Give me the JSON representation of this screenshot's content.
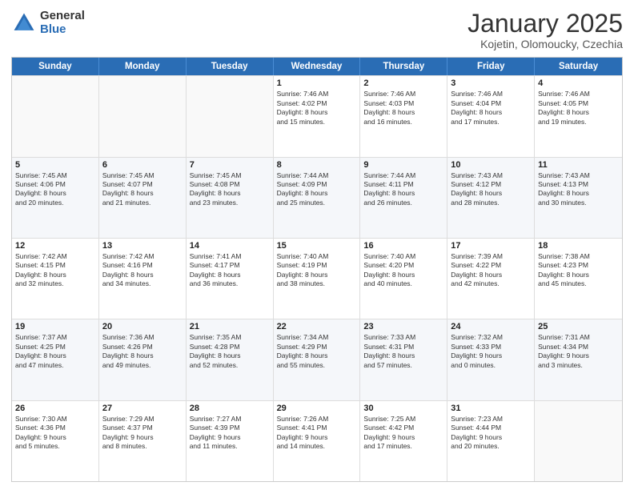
{
  "logo": {
    "general": "General",
    "blue": "Blue"
  },
  "title": {
    "month": "January 2025",
    "location": "Kojetin, Olomoucky, Czechia"
  },
  "days": [
    "Sunday",
    "Monday",
    "Tuesday",
    "Wednesday",
    "Thursday",
    "Friday",
    "Saturday"
  ],
  "weeks": [
    [
      {
        "day": "",
        "lines": [],
        "empty": true
      },
      {
        "day": "",
        "lines": [],
        "empty": true
      },
      {
        "day": "",
        "lines": [],
        "empty": true
      },
      {
        "day": "1",
        "lines": [
          "Sunrise: 7:46 AM",
          "Sunset: 4:02 PM",
          "Daylight: 8 hours",
          "and 15 minutes."
        ],
        "empty": false
      },
      {
        "day": "2",
        "lines": [
          "Sunrise: 7:46 AM",
          "Sunset: 4:03 PM",
          "Daylight: 8 hours",
          "and 16 minutes."
        ],
        "empty": false
      },
      {
        "day": "3",
        "lines": [
          "Sunrise: 7:46 AM",
          "Sunset: 4:04 PM",
          "Daylight: 8 hours",
          "and 17 minutes."
        ],
        "empty": false
      },
      {
        "day": "4",
        "lines": [
          "Sunrise: 7:46 AM",
          "Sunset: 4:05 PM",
          "Daylight: 8 hours",
          "and 19 minutes."
        ],
        "empty": false
      }
    ],
    [
      {
        "day": "5",
        "lines": [
          "Sunrise: 7:45 AM",
          "Sunset: 4:06 PM",
          "Daylight: 8 hours",
          "and 20 minutes."
        ],
        "empty": false
      },
      {
        "day": "6",
        "lines": [
          "Sunrise: 7:45 AM",
          "Sunset: 4:07 PM",
          "Daylight: 8 hours",
          "and 21 minutes."
        ],
        "empty": false
      },
      {
        "day": "7",
        "lines": [
          "Sunrise: 7:45 AM",
          "Sunset: 4:08 PM",
          "Daylight: 8 hours",
          "and 23 minutes."
        ],
        "empty": false
      },
      {
        "day": "8",
        "lines": [
          "Sunrise: 7:44 AM",
          "Sunset: 4:09 PM",
          "Daylight: 8 hours",
          "and 25 minutes."
        ],
        "empty": false
      },
      {
        "day": "9",
        "lines": [
          "Sunrise: 7:44 AM",
          "Sunset: 4:11 PM",
          "Daylight: 8 hours",
          "and 26 minutes."
        ],
        "empty": false
      },
      {
        "day": "10",
        "lines": [
          "Sunrise: 7:43 AM",
          "Sunset: 4:12 PM",
          "Daylight: 8 hours",
          "and 28 minutes."
        ],
        "empty": false
      },
      {
        "day": "11",
        "lines": [
          "Sunrise: 7:43 AM",
          "Sunset: 4:13 PM",
          "Daylight: 8 hours",
          "and 30 minutes."
        ],
        "empty": false
      }
    ],
    [
      {
        "day": "12",
        "lines": [
          "Sunrise: 7:42 AM",
          "Sunset: 4:15 PM",
          "Daylight: 8 hours",
          "and 32 minutes."
        ],
        "empty": false
      },
      {
        "day": "13",
        "lines": [
          "Sunrise: 7:42 AM",
          "Sunset: 4:16 PM",
          "Daylight: 8 hours",
          "and 34 minutes."
        ],
        "empty": false
      },
      {
        "day": "14",
        "lines": [
          "Sunrise: 7:41 AM",
          "Sunset: 4:17 PM",
          "Daylight: 8 hours",
          "and 36 minutes."
        ],
        "empty": false
      },
      {
        "day": "15",
        "lines": [
          "Sunrise: 7:40 AM",
          "Sunset: 4:19 PM",
          "Daylight: 8 hours",
          "and 38 minutes."
        ],
        "empty": false
      },
      {
        "day": "16",
        "lines": [
          "Sunrise: 7:40 AM",
          "Sunset: 4:20 PM",
          "Daylight: 8 hours",
          "and 40 minutes."
        ],
        "empty": false
      },
      {
        "day": "17",
        "lines": [
          "Sunrise: 7:39 AM",
          "Sunset: 4:22 PM",
          "Daylight: 8 hours",
          "and 42 minutes."
        ],
        "empty": false
      },
      {
        "day": "18",
        "lines": [
          "Sunrise: 7:38 AM",
          "Sunset: 4:23 PM",
          "Daylight: 8 hours",
          "and 45 minutes."
        ],
        "empty": false
      }
    ],
    [
      {
        "day": "19",
        "lines": [
          "Sunrise: 7:37 AM",
          "Sunset: 4:25 PM",
          "Daylight: 8 hours",
          "and 47 minutes."
        ],
        "empty": false
      },
      {
        "day": "20",
        "lines": [
          "Sunrise: 7:36 AM",
          "Sunset: 4:26 PM",
          "Daylight: 8 hours",
          "and 49 minutes."
        ],
        "empty": false
      },
      {
        "day": "21",
        "lines": [
          "Sunrise: 7:35 AM",
          "Sunset: 4:28 PM",
          "Daylight: 8 hours",
          "and 52 minutes."
        ],
        "empty": false
      },
      {
        "day": "22",
        "lines": [
          "Sunrise: 7:34 AM",
          "Sunset: 4:29 PM",
          "Daylight: 8 hours",
          "and 55 minutes."
        ],
        "empty": false
      },
      {
        "day": "23",
        "lines": [
          "Sunrise: 7:33 AM",
          "Sunset: 4:31 PM",
          "Daylight: 8 hours",
          "and 57 minutes."
        ],
        "empty": false
      },
      {
        "day": "24",
        "lines": [
          "Sunrise: 7:32 AM",
          "Sunset: 4:33 PM",
          "Daylight: 9 hours",
          "and 0 minutes."
        ],
        "empty": false
      },
      {
        "day": "25",
        "lines": [
          "Sunrise: 7:31 AM",
          "Sunset: 4:34 PM",
          "Daylight: 9 hours",
          "and 3 minutes."
        ],
        "empty": false
      }
    ],
    [
      {
        "day": "26",
        "lines": [
          "Sunrise: 7:30 AM",
          "Sunset: 4:36 PM",
          "Daylight: 9 hours",
          "and 5 minutes."
        ],
        "empty": false
      },
      {
        "day": "27",
        "lines": [
          "Sunrise: 7:29 AM",
          "Sunset: 4:37 PM",
          "Daylight: 9 hours",
          "and 8 minutes."
        ],
        "empty": false
      },
      {
        "day": "28",
        "lines": [
          "Sunrise: 7:27 AM",
          "Sunset: 4:39 PM",
          "Daylight: 9 hours",
          "and 11 minutes."
        ],
        "empty": false
      },
      {
        "day": "29",
        "lines": [
          "Sunrise: 7:26 AM",
          "Sunset: 4:41 PM",
          "Daylight: 9 hours",
          "and 14 minutes."
        ],
        "empty": false
      },
      {
        "day": "30",
        "lines": [
          "Sunrise: 7:25 AM",
          "Sunset: 4:42 PM",
          "Daylight: 9 hours",
          "and 17 minutes."
        ],
        "empty": false
      },
      {
        "day": "31",
        "lines": [
          "Sunrise: 7:23 AM",
          "Sunset: 4:44 PM",
          "Daylight: 9 hours",
          "and 20 minutes."
        ],
        "empty": false
      },
      {
        "day": "",
        "lines": [],
        "empty": true
      }
    ]
  ]
}
